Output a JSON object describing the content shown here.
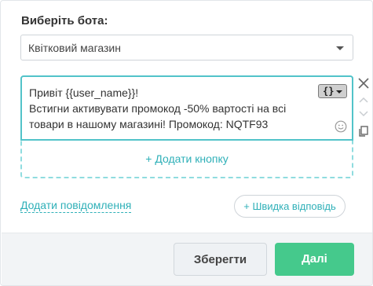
{
  "form": {
    "bot_label": "Виберіть бота:",
    "bot_selected": "Квітковий магазин"
  },
  "message": {
    "line1": "Привіт {{user_name}}!",
    "line2": "Встигни активувати промокод -50% вартості на всі",
    "line3": "товари в нашому магазині! Промокод: NQTF93",
    "variable_button": "{}",
    "add_button_label": "+ Додати кнопку"
  },
  "actions": {
    "add_message": "Додати повідомлення",
    "quick_reply": "+ Швидка відповідь"
  },
  "footer": {
    "save_label": "Зберегти",
    "next_label": "Далі"
  },
  "colors": {
    "accent": "#2fb0b8",
    "primary_button": "#45c98c",
    "focus_border": "#52c3c9"
  },
  "icons": [
    "chevron-down-icon",
    "close-icon",
    "arrow-up-icon",
    "arrow-down-icon",
    "copy-icon",
    "smile-icon"
  ]
}
